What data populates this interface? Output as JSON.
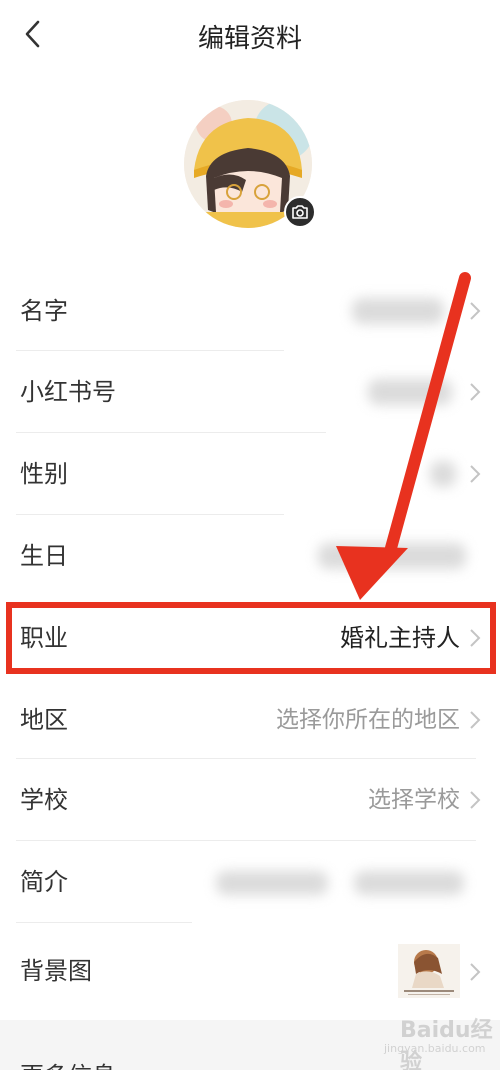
{
  "header": {
    "title": "编辑资料"
  },
  "rows": [
    {
      "label": "名字",
      "value": ""
    },
    {
      "label": "小红书号",
      "value": ""
    },
    {
      "label": "性别",
      "value": ""
    },
    {
      "label": "生日",
      "value": ""
    },
    {
      "label": "职业",
      "value": "婚礼主持人"
    },
    {
      "label": "地区",
      "value": "选择你所在的地区"
    },
    {
      "label": "学校",
      "value": "选择学校"
    },
    {
      "label": "简介",
      "value": ""
    },
    {
      "label": "背景图",
      "value": ""
    }
  ],
  "more": {
    "label": "更多信息"
  },
  "watermark": {
    "text": "Baidu经验",
    "sub": "jingyan.baidu.com"
  },
  "colors": {
    "highlight": "#e8321f",
    "placeholder": "#9a9a9a",
    "text": "#333333"
  }
}
